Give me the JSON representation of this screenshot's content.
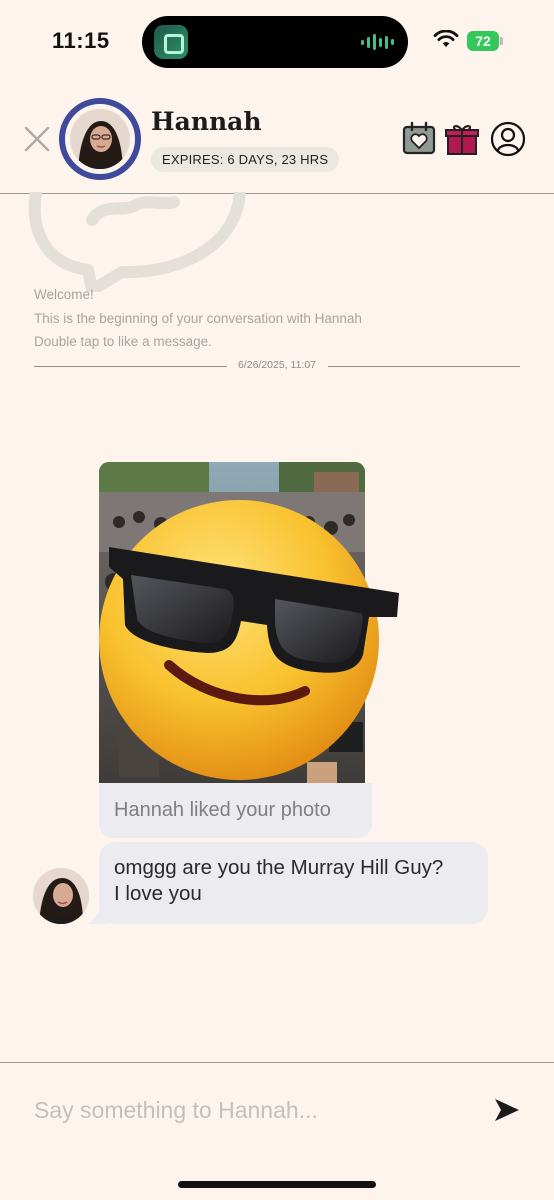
{
  "status_bar": {
    "time": "11:15",
    "battery": "72",
    "icons": [
      "wifi-icon",
      "battery-icon"
    ]
  },
  "header": {
    "name": "Hannah",
    "expires": "EXPIRES: 6 DAYS, 23 HRS",
    "icons": [
      "close-icon",
      "calendar-heart-icon",
      "gift-icon",
      "profile-icon"
    ]
  },
  "intro": {
    "line1": "Welcome!",
    "line2": "This is the beginning of your conversation with Hannah",
    "line3": "Double tap to like a message."
  },
  "divider": {
    "date": "6/26/2025, 11:07"
  },
  "messages": {
    "photo_caption": "Hannah liked your photo",
    "incoming_line1": "omggg are you the Murray Hill Guy?",
    "incoming_line2": "I love you"
  },
  "composer": {
    "placeholder": "Say something to Hannah..."
  },
  "colors": {
    "background": "#fdf4ee",
    "avatar_ring": "#3f4a9a",
    "bubble": "#ecebef",
    "gift": "#b0184e",
    "battery": "#34c759"
  }
}
